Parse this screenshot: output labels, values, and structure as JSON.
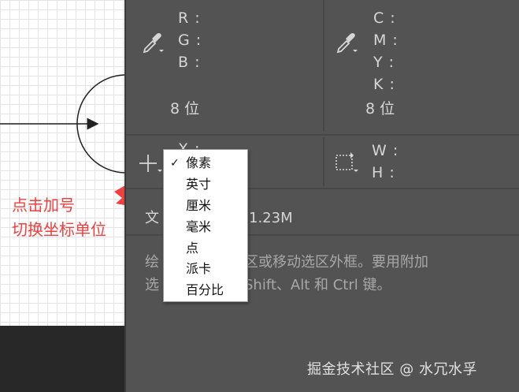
{
  "annotation": {
    "line1": "点击加号",
    "line2": "切换坐标单位"
  },
  "info_panel": {
    "rgb": {
      "r": "R :",
      "g": "G :",
      "b": "B :",
      "bits": "8 位",
      "icon": "eyedropper-icon"
    },
    "cmyk": {
      "c": "C :",
      "m": "M :",
      "y": "Y :",
      "k": "K :",
      "bits": "8 位",
      "icon": "eyedropper-icon"
    },
    "position": {
      "x": "X :",
      "icon": "crosshair-plus-icon"
    },
    "size": {
      "w": "W :",
      "h": "H :",
      "icon": "selection-rect-icon"
    },
    "doc_prefix": "文",
    "doc_value": "1.23M",
    "help_line1_a": "绘",
    "help_line1_b": "区或移动选区外框。要用附加",
    "help_line2_a": "选",
    "help_line2_b": "Shift、Alt 和 Ctrl 键。"
  },
  "unit_menu": {
    "selected": "像素",
    "check": "✓",
    "items": [
      "像素",
      "英寸",
      "厘米",
      "毫米",
      "点",
      "派卡",
      "百分比"
    ]
  },
  "watermark": "掘金技术社区 @ 水冗水孚",
  "colors": {
    "annotation": "#ef3f3f",
    "panel_bg": "#535353",
    "menu_bg": "#ffffff"
  }
}
